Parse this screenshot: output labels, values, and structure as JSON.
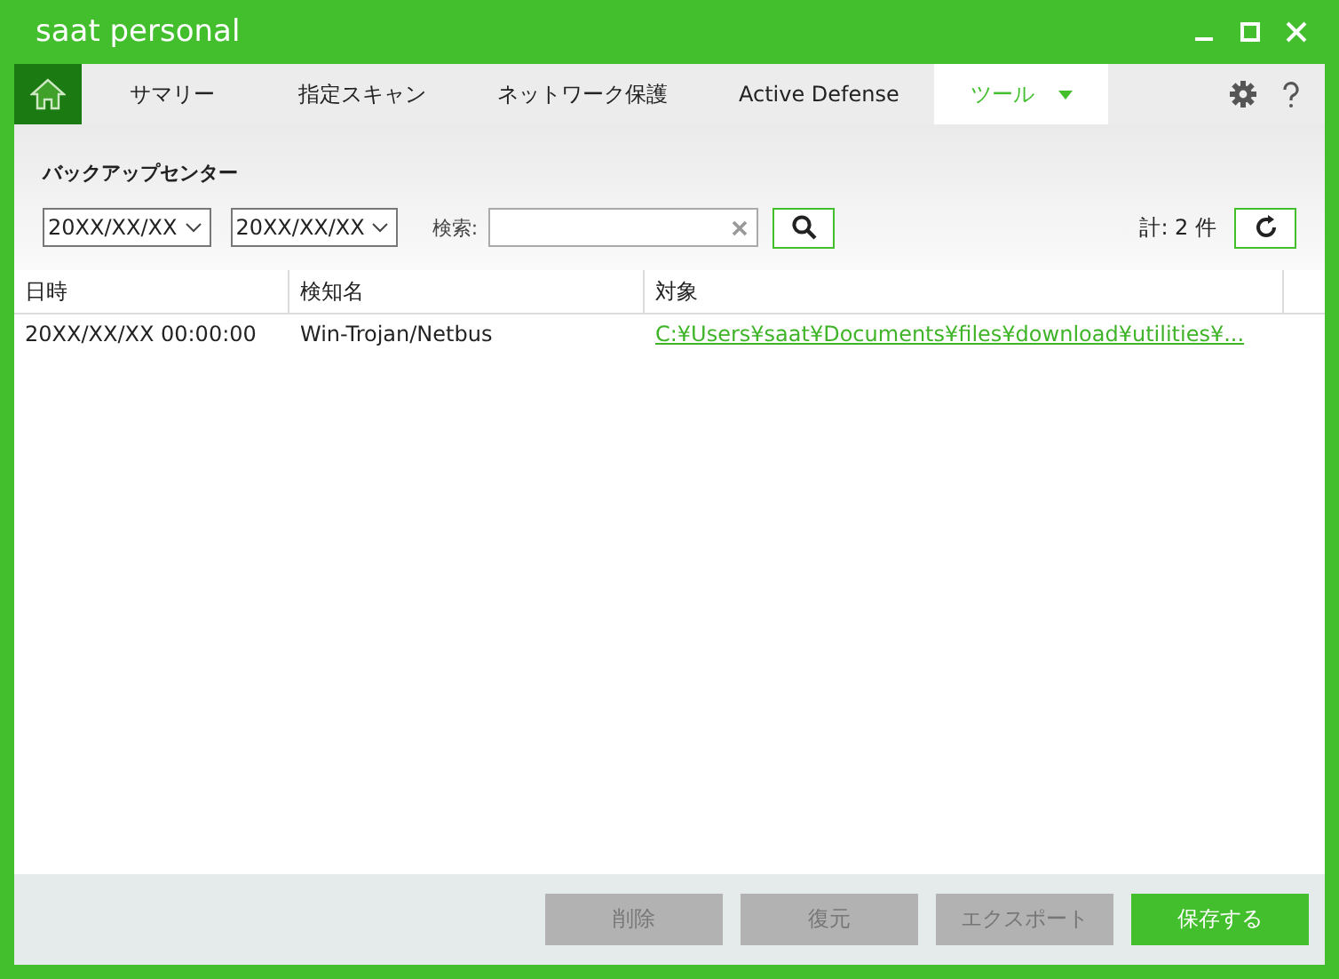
{
  "window": {
    "title": "saat personal"
  },
  "tabs": [
    {
      "kind": "home",
      "selected": false
    },
    {
      "label": "サマリー",
      "selected": false
    },
    {
      "label": "指定スキャン",
      "selected": false
    },
    {
      "label": "ネットワーク保護",
      "selected": false
    },
    {
      "label": "Active Defense",
      "selected": false
    },
    {
      "label": "ツール",
      "selected": true,
      "dropdown": true
    }
  ],
  "section_title": "バックアップセンター",
  "filters": {
    "date_from": "20XX/XX/XX",
    "date_to": "20XX/XX/XX",
    "search_label": "検索:",
    "count": "計: 2 件"
  },
  "table": {
    "columns": [
      "日時",
      "検知名",
      "対象"
    ],
    "rows": [
      {
        "cells": [
          "20XX/XX/XX 00:00:00",
          "Win-Trojan/Netbus",
          "C:¥Users¥saat¥Documents¥files¥download¥utilities¥..."
        ]
      }
    ]
  },
  "buttons": [
    {
      "label": "削除",
      "disabled": true
    },
    {
      "label": "復元",
      "disabled": true
    },
    {
      "label": "エクスポート",
      "disabled": true
    },
    {
      "label": "保存する",
      "disabled": false
    }
  ]
}
